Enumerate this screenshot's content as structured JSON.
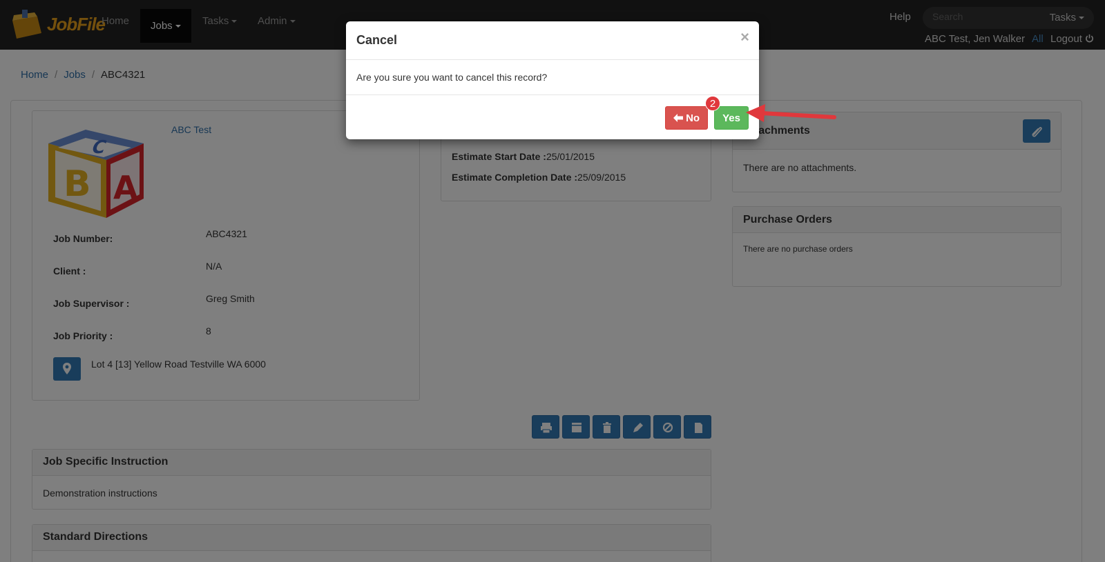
{
  "nav": {
    "brand": "JobFile",
    "items": [
      {
        "label": "Home"
      },
      {
        "label": "Jobs"
      },
      {
        "label": "Tasks"
      },
      {
        "label": "Admin"
      }
    ],
    "help": "Help",
    "search_placeholder": "Search",
    "search_scope": "Tasks",
    "user": "ABC Test, Jen Walker",
    "all": "All",
    "logout": "Logout"
  },
  "breadcrumb": {
    "home": "Home",
    "jobs": "Jobs",
    "current": "ABC4321"
  },
  "job": {
    "client_link": "ABC Test",
    "job_number_label": "Job Number:",
    "job_number": "ABC4321",
    "client_label": "Client :",
    "client": "N/A",
    "supervisor_label": "Job Supervisor :",
    "supervisor": "Greg Smith",
    "priority_label": "Job Priority :",
    "priority": "8",
    "address": "Lot 4 [13] Yellow Road Testville WA 6000"
  },
  "estimates": {
    "start_label": "Estimate Start Date :",
    "start": "25/01/2015",
    "completion_label": "Estimate Completion Date :",
    "completion": "25/09/2015"
  },
  "attachments": {
    "title": "Attachments",
    "empty": "There are no attachments."
  },
  "purchase_orders": {
    "title": "Purchase Orders",
    "empty": "There are no purchase orders"
  },
  "instruction": {
    "title": "Job Specific Instruction",
    "text": "Demonstration instructions"
  },
  "directions": {
    "title": "Standard Directions"
  },
  "modal": {
    "title": "Cancel",
    "close": "×",
    "message": "Are you sure you want to cancel this record?",
    "no": "No",
    "yes": "Yes"
  },
  "annotation": {
    "step": "2"
  },
  "colors": {
    "primary": "#337ab7",
    "danger": "#d9534f",
    "success": "#5cb85c",
    "navbar": "#222222"
  }
}
